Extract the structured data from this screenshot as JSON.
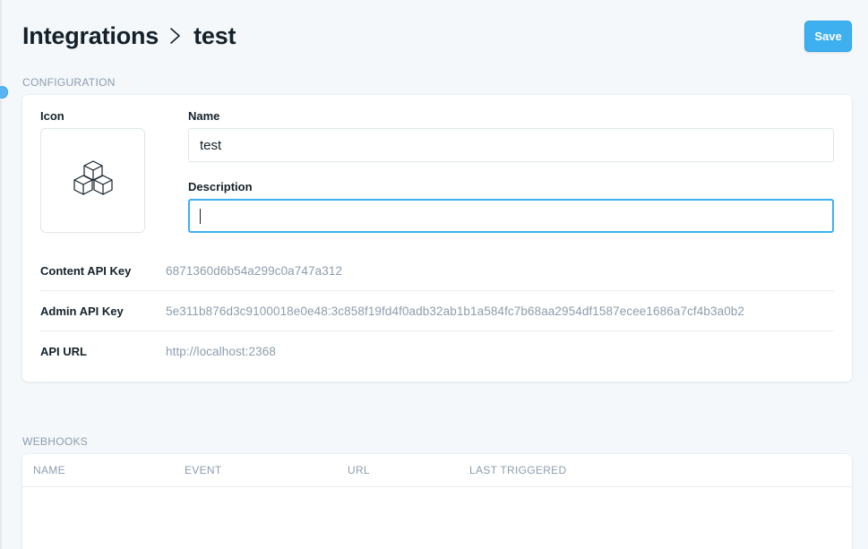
{
  "header": {
    "breadcrumb_parent": "Integrations",
    "breadcrumb_current": "test",
    "save_label": "Save"
  },
  "configuration": {
    "section_title": "CONFIGURATION",
    "icon_label": "Icon",
    "icon_name": "cubes-icon",
    "name_label": "Name",
    "name_value": "test",
    "description_label": "Description",
    "description_value": "",
    "content_api_key_label": "Content API Key",
    "content_api_key_value": "6871360d6b54a299c0a747a312",
    "admin_api_key_label": "Admin API Key",
    "admin_api_key_value": "5e311b876d3c9100018e0e48:3c858f19fd4f0adb32ab1b1a584fc7b68aa2954df1587ecee1686a7cf4b3a0b2",
    "api_url_label": "API URL",
    "api_url_value": "http://localhost:2368"
  },
  "webhooks": {
    "section_title": "WEBHOOKS",
    "columns": [
      "NAME",
      "EVENT",
      "URL",
      "LAST TRIGGERED"
    ]
  },
  "colors": {
    "accent": "#3eb0ef",
    "muted_text": "#8e9cac",
    "background": "#f4f8fb"
  }
}
